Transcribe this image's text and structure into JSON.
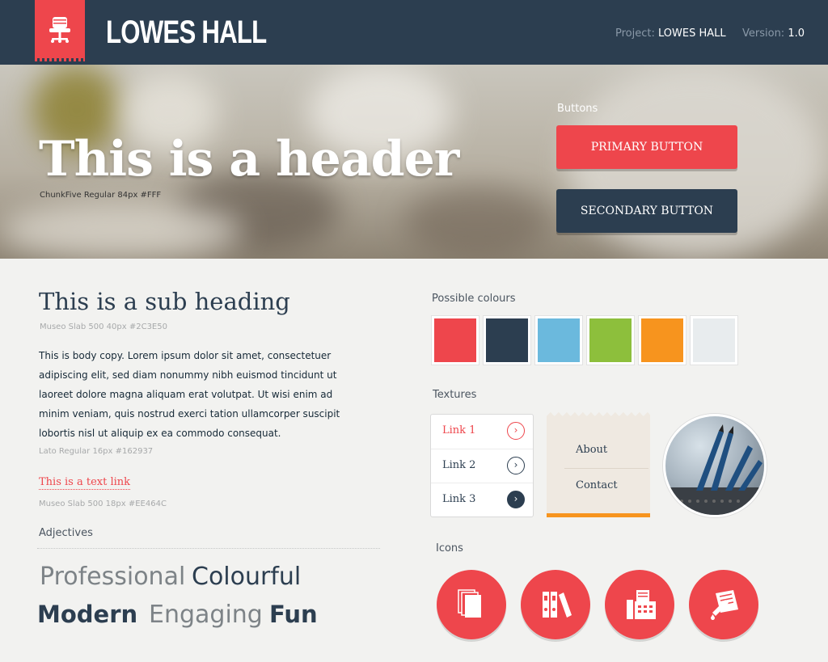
{
  "header": {
    "brand": "LOWES HALL",
    "project_label": "Project:",
    "project_value": "LOWES HALL",
    "version_label": "Version:",
    "version_value": "1.0",
    "logo_icon": "chair-icon"
  },
  "hero": {
    "title": "This is a header",
    "caption": "ChunkFive Regular 84px  #FFF",
    "buttons_label": "Buttons",
    "primary_button": "PRIMARY BUTTON",
    "secondary_button": "SECONDARY BUTTON"
  },
  "typography": {
    "sub_heading": "This is a sub heading",
    "sub_heading_caption": "Museo Slab 500  40px  #2C3E50",
    "body_copy": "This is body copy. Lorem ipsum dolor sit amet, consectetuer adipiscing elit, sed diam nonummy nibh euismod tincidunt ut laoreet dolore magna aliquam erat volutpat. Ut wisi enim ad minim veniam, quis nostrud exerci tation ullamcorper suscipit lobortis nisl ut aliquip ex ea commodo consequat.",
    "body_caption": "Lato Regular 16px  #162937",
    "text_link": "This is a text link",
    "text_link_caption": "Museo Slab 500 18px  #EE464C"
  },
  "adjectives": {
    "label": "Adjectives",
    "words": [
      "Professional",
      "Colourful",
      "Modern",
      "Engaging",
      "Fun"
    ]
  },
  "colours": {
    "label": "Possible colours",
    "swatches": [
      "#ee464c",
      "#2c3e50",
      "#6bb9dd",
      "#8dbf3c",
      "#f7941e",
      "#e8ecee"
    ]
  },
  "textures": {
    "label": "Textures",
    "links": [
      "Link 1",
      "Link 2",
      "Link 3"
    ],
    "menu": [
      "About",
      "Contact"
    ]
  },
  "icons": {
    "label": "Icons",
    "items": [
      "documents-icon",
      "binders-icon",
      "fax-icon",
      "pen-paper-icon"
    ]
  },
  "colors": {
    "accent": "#ee464c",
    "navy": "#2c3e50",
    "orange": "#f7941e"
  }
}
